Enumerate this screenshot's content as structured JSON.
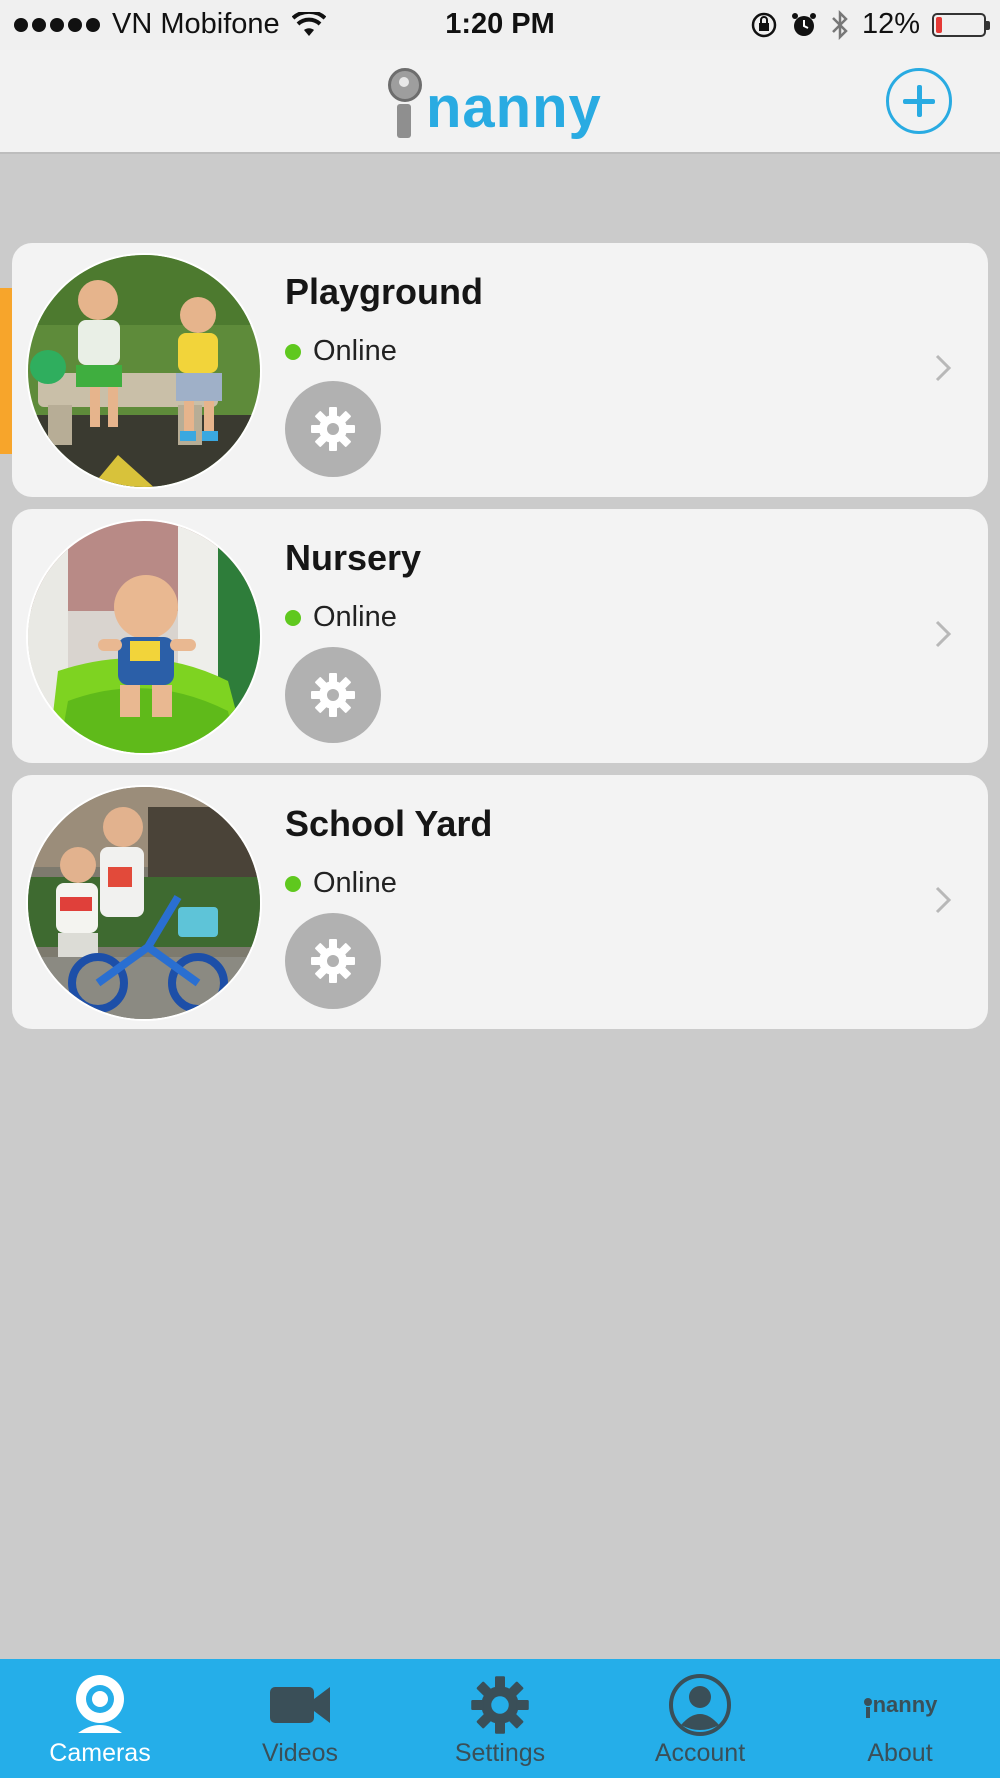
{
  "status_bar": {
    "carrier": "VN Mobifone",
    "time": "1:20 PM",
    "battery": "12%",
    "battery_level": 0.12
  },
  "header": {
    "logo_text": "nanny",
    "add_icon": "plus-circle-icon"
  },
  "cameras": [
    {
      "name": "Playground",
      "status": "Online",
      "status_color": "#5fc81e"
    },
    {
      "name": "Nursery",
      "status": "Online",
      "status_color": "#5fc81e"
    },
    {
      "name": "School Yard",
      "status": "Online",
      "status_color": "#5fc81e"
    }
  ],
  "tabs": [
    {
      "label": "Cameras",
      "icon": "webcam-icon",
      "active": true
    },
    {
      "label": "Videos",
      "icon": "video-camera-icon",
      "active": false
    },
    {
      "label": "Settings",
      "icon": "gear-icon",
      "active": false
    },
    {
      "label": "Account",
      "icon": "user-icon",
      "active": false
    },
    {
      "label": "About",
      "icon": "inanny-logo-icon",
      "active": false
    }
  ],
  "tab_about_logo": "nanny",
  "colors": {
    "accent": "#25aee9",
    "background": "#cbcbcb",
    "card": "#f3f3f3",
    "online": "#5fc81e",
    "side_accent": "#f7a52b"
  }
}
